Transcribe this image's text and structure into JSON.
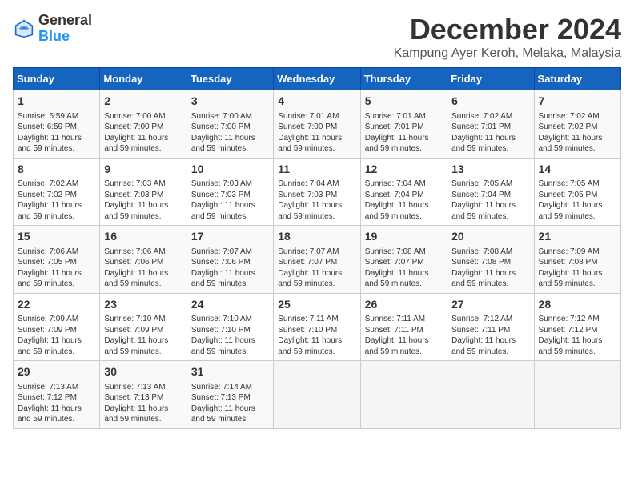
{
  "logo": {
    "general": "General",
    "blue": "Blue"
  },
  "title": "December 2024",
  "subtitle": "Kampung Ayer Keroh, Melaka, Malaysia",
  "headers": [
    "Sunday",
    "Monday",
    "Tuesday",
    "Wednesday",
    "Thursday",
    "Friday",
    "Saturday"
  ],
  "weeks": [
    [
      {
        "day": "1",
        "sunrise": "6:59 AM",
        "sunset": "6:59 PM",
        "daylight": "11 hours and 59 minutes."
      },
      {
        "day": "2",
        "sunrise": "7:00 AM",
        "sunset": "7:00 PM",
        "daylight": "11 hours and 59 minutes."
      },
      {
        "day": "3",
        "sunrise": "7:00 AM",
        "sunset": "7:00 PM",
        "daylight": "11 hours and 59 minutes."
      },
      {
        "day": "4",
        "sunrise": "7:01 AM",
        "sunset": "7:00 PM",
        "daylight": "11 hours and 59 minutes."
      },
      {
        "day": "5",
        "sunrise": "7:01 AM",
        "sunset": "7:01 PM",
        "daylight": "11 hours and 59 minutes."
      },
      {
        "day": "6",
        "sunrise": "7:02 AM",
        "sunset": "7:01 PM",
        "daylight": "11 hours and 59 minutes."
      },
      {
        "day": "7",
        "sunrise": "7:02 AM",
        "sunset": "7:02 PM",
        "daylight": "11 hours and 59 minutes."
      }
    ],
    [
      {
        "day": "8",
        "sunrise": "7:02 AM",
        "sunset": "7:02 PM",
        "daylight": "11 hours and 59 minutes."
      },
      {
        "day": "9",
        "sunrise": "7:03 AM",
        "sunset": "7:03 PM",
        "daylight": "11 hours and 59 minutes."
      },
      {
        "day": "10",
        "sunrise": "7:03 AM",
        "sunset": "7:03 PM",
        "daylight": "11 hours and 59 minutes."
      },
      {
        "day": "11",
        "sunrise": "7:04 AM",
        "sunset": "7:03 PM",
        "daylight": "11 hours and 59 minutes."
      },
      {
        "day": "12",
        "sunrise": "7:04 AM",
        "sunset": "7:04 PM",
        "daylight": "11 hours and 59 minutes."
      },
      {
        "day": "13",
        "sunrise": "7:05 AM",
        "sunset": "7:04 PM",
        "daylight": "11 hours and 59 minutes."
      },
      {
        "day": "14",
        "sunrise": "7:05 AM",
        "sunset": "7:05 PM",
        "daylight": "11 hours and 59 minutes."
      }
    ],
    [
      {
        "day": "15",
        "sunrise": "7:06 AM",
        "sunset": "7:05 PM",
        "daylight": "11 hours and 59 minutes."
      },
      {
        "day": "16",
        "sunrise": "7:06 AM",
        "sunset": "7:06 PM",
        "daylight": "11 hours and 59 minutes."
      },
      {
        "day": "17",
        "sunrise": "7:07 AM",
        "sunset": "7:06 PM",
        "daylight": "11 hours and 59 minutes."
      },
      {
        "day": "18",
        "sunrise": "7:07 AM",
        "sunset": "7:07 PM",
        "daylight": "11 hours and 59 minutes."
      },
      {
        "day": "19",
        "sunrise": "7:08 AM",
        "sunset": "7:07 PM",
        "daylight": "11 hours and 59 minutes."
      },
      {
        "day": "20",
        "sunrise": "7:08 AM",
        "sunset": "7:08 PM",
        "daylight": "11 hours and 59 minutes."
      },
      {
        "day": "21",
        "sunrise": "7:09 AM",
        "sunset": "7:08 PM",
        "daylight": "11 hours and 59 minutes."
      }
    ],
    [
      {
        "day": "22",
        "sunrise": "7:09 AM",
        "sunset": "7:09 PM",
        "daylight": "11 hours and 59 minutes."
      },
      {
        "day": "23",
        "sunrise": "7:10 AM",
        "sunset": "7:09 PM",
        "daylight": "11 hours and 59 minutes."
      },
      {
        "day": "24",
        "sunrise": "7:10 AM",
        "sunset": "7:10 PM",
        "daylight": "11 hours and 59 minutes."
      },
      {
        "day": "25",
        "sunrise": "7:11 AM",
        "sunset": "7:10 PM",
        "daylight": "11 hours and 59 minutes."
      },
      {
        "day": "26",
        "sunrise": "7:11 AM",
        "sunset": "7:11 PM",
        "daylight": "11 hours and 59 minutes."
      },
      {
        "day": "27",
        "sunrise": "7:12 AM",
        "sunset": "7:11 PM",
        "daylight": "11 hours and 59 minutes."
      },
      {
        "day": "28",
        "sunrise": "7:12 AM",
        "sunset": "7:12 PM",
        "daylight": "11 hours and 59 minutes."
      }
    ],
    [
      {
        "day": "29",
        "sunrise": "7:13 AM",
        "sunset": "7:12 PM",
        "daylight": "11 hours and 59 minutes."
      },
      {
        "day": "30",
        "sunrise": "7:13 AM",
        "sunset": "7:13 PM",
        "daylight": "11 hours and 59 minutes."
      },
      {
        "day": "31",
        "sunrise": "7:14 AM",
        "sunset": "7:13 PM",
        "daylight": "11 hours and 59 minutes."
      },
      null,
      null,
      null,
      null
    ]
  ],
  "labels": {
    "sunrise": "Sunrise:",
    "sunset": "Sunset:",
    "daylight": "Daylight:"
  }
}
